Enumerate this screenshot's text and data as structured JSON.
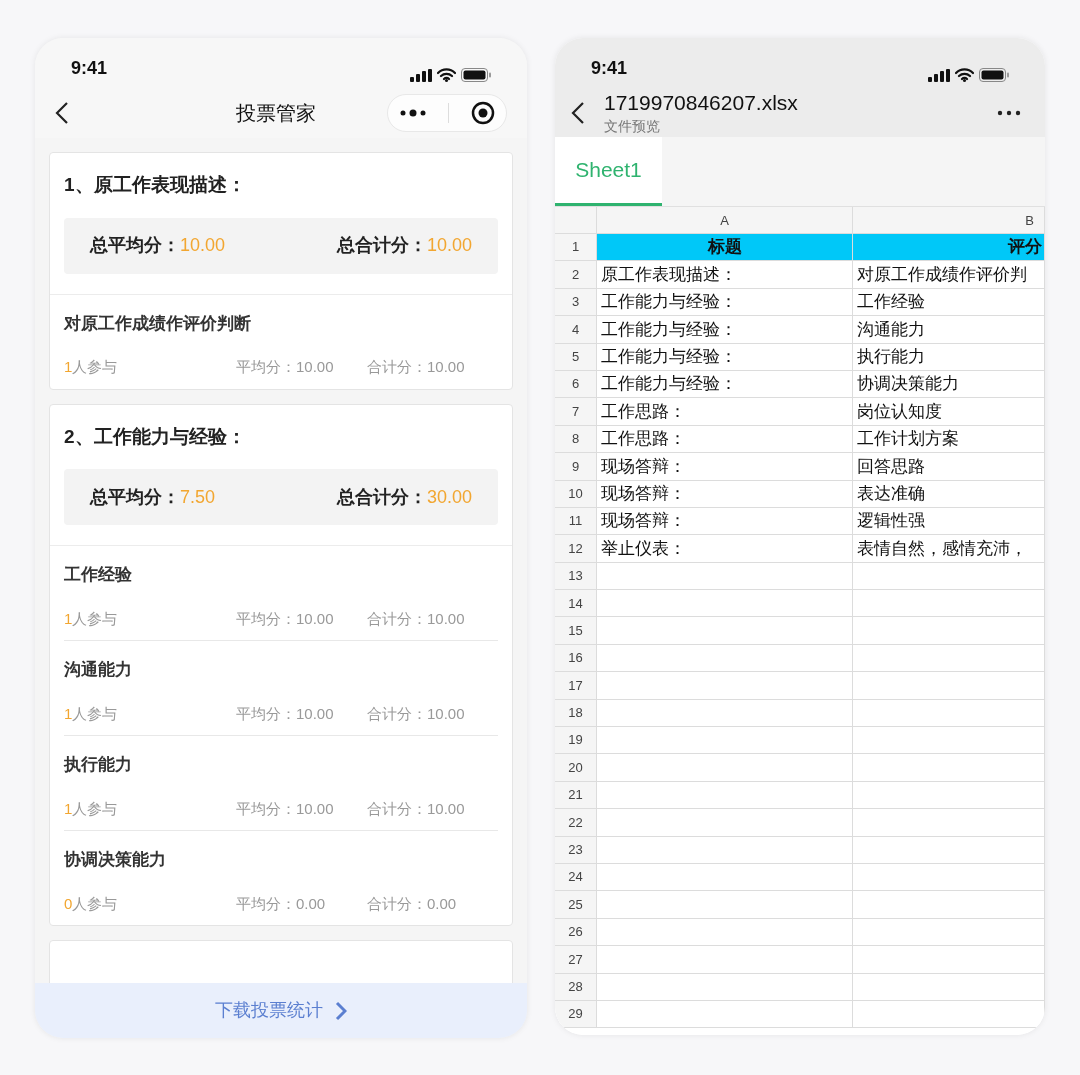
{
  "vote_app": {
    "status_time": "9:41",
    "title": "投票管家",
    "sections": [
      {
        "title": "1、原工作表现描述：",
        "avg_label": "总平均分：",
        "avg": "10.00",
        "total_label": "总合计分：",
        "total": "10.00",
        "items": [
          {
            "name": "对原工作成绩作评价判断",
            "count": "1",
            "count_suffix": "人参与",
            "avg_label": "平均分：",
            "avg": "10.00",
            "total_label": "合计分：",
            "total": "10.00"
          }
        ]
      },
      {
        "title": "2、工作能力与经验：",
        "avg_label": "总平均分：",
        "avg": "7.50",
        "total_label": "总合计分：",
        "total": "30.00",
        "items": [
          {
            "name": "工作经验",
            "count": "1",
            "count_suffix": "人参与",
            "avg_label": "平均分：",
            "avg": "10.00",
            "total_label": "合计分：",
            "total": "10.00"
          },
          {
            "name": "沟通能力",
            "count": "1",
            "count_suffix": "人参与",
            "avg_label": "平均分：",
            "avg": "10.00",
            "total_label": "合计分：",
            "total": "10.00"
          },
          {
            "name": "执行能力",
            "count": "1",
            "count_suffix": "人参与",
            "avg_label": "平均分：",
            "avg": "10.00",
            "total_label": "合计分：",
            "total": "10.00"
          },
          {
            "name": "协调决策能力",
            "count": "0",
            "count_suffix": "人参与",
            "avg_label": "平均分：",
            "avg": "0.00",
            "total_label": "合计分：",
            "total": "0.00"
          }
        ]
      }
    ],
    "download_button": "下载投票统计"
  },
  "file_preview": {
    "status_time": "9:41",
    "file_name": "1719970846207.xlsx",
    "subtitle": "文件预览",
    "tabs": [
      {
        "label": "Sheet1",
        "selected": true
      }
    ],
    "columns": [
      "A",
      "B"
    ],
    "rows": [
      {
        "number": "1",
        "kind": "header",
        "cells": [
          "标题",
          "评分"
        ]
      },
      {
        "number": "2",
        "cells": [
          "原工作表现描述：",
          "对原工作成绩作评价判"
        ]
      },
      {
        "number": "3",
        "cells": [
          "工作能力与经验：",
          "工作经验"
        ]
      },
      {
        "number": "4",
        "cells": [
          "工作能力与经验：",
          "沟通能力"
        ]
      },
      {
        "number": "5",
        "cells": [
          "工作能力与经验：",
          "执行能力"
        ]
      },
      {
        "number": "6",
        "cells": [
          "工作能力与经验：",
          "协调决策能力"
        ]
      },
      {
        "number": "7",
        "cells": [
          "工作思路：",
          "岗位认知度"
        ]
      },
      {
        "number": "8",
        "cells": [
          "工作思路：",
          "工作计划方案"
        ]
      },
      {
        "number": "9",
        "cells": [
          "现场答辩：",
          "回答思路"
        ]
      },
      {
        "number": "10",
        "cells": [
          "现场答辩：",
          "表达准确"
        ]
      },
      {
        "number": "11",
        "cells": [
          "现场答辩：",
          "逻辑性强"
        ]
      },
      {
        "number": "12",
        "cells": [
          "举止仪表：",
          "表情自然，感情充沛，"
        ]
      },
      {
        "number": "13"
      },
      {
        "number": "14"
      },
      {
        "number": "15"
      },
      {
        "number": "16"
      },
      {
        "number": "17"
      },
      {
        "number": "18"
      },
      {
        "number": "19"
      },
      {
        "number": "20"
      },
      {
        "number": "21"
      },
      {
        "number": "22"
      },
      {
        "number": "23"
      },
      {
        "number": "24"
      },
      {
        "number": "25"
      },
      {
        "number": "26"
      },
      {
        "number": "27"
      },
      {
        "number": "28"
      },
      {
        "number": "29"
      }
    ]
  }
}
